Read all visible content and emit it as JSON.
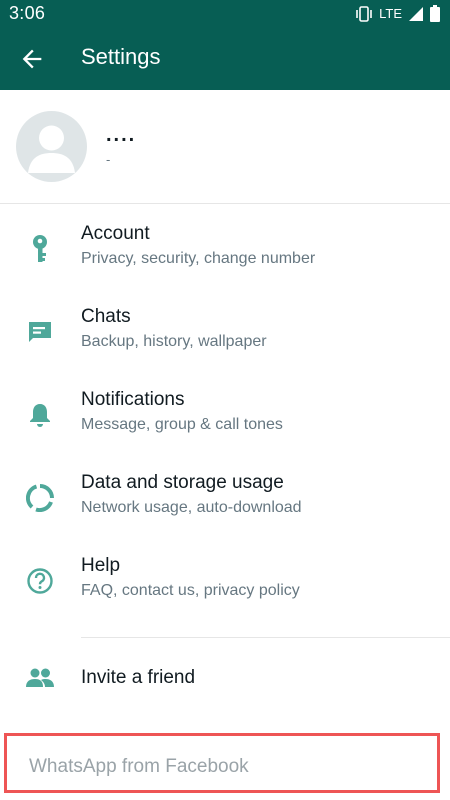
{
  "status_bar": {
    "time": "3:06",
    "network": "LTE",
    "icons": [
      "vibrate-icon",
      "signal-icon",
      "battery-icon"
    ]
  },
  "app_bar": {
    "title": "Settings",
    "back_icon": "arrow-left-icon",
    "color": "#075e54"
  },
  "profile": {
    "name": "....",
    "about": "-"
  },
  "menu": {
    "accent_color": "#4fa89a",
    "items": [
      {
        "icon": "key-icon",
        "title": "Account",
        "subtitle": "Privacy, security, change number"
      },
      {
        "icon": "chat-icon",
        "title": "Chats",
        "subtitle": "Backup, history, wallpaper"
      },
      {
        "icon": "bell-icon",
        "title": "Notifications",
        "subtitle": "Message, group & call tones"
      },
      {
        "icon": "data-usage-icon",
        "title": "Data and storage usage",
        "subtitle": "Network usage, auto-download"
      },
      {
        "icon": "help-icon",
        "title": "Help",
        "subtitle": "FAQ, contact us, privacy policy"
      }
    ],
    "invite": {
      "icon": "people-icon",
      "title": "Invite a friend"
    }
  },
  "footer": {
    "text": "WhatsApp from Facebook",
    "highlight_color": "#ee5555"
  }
}
